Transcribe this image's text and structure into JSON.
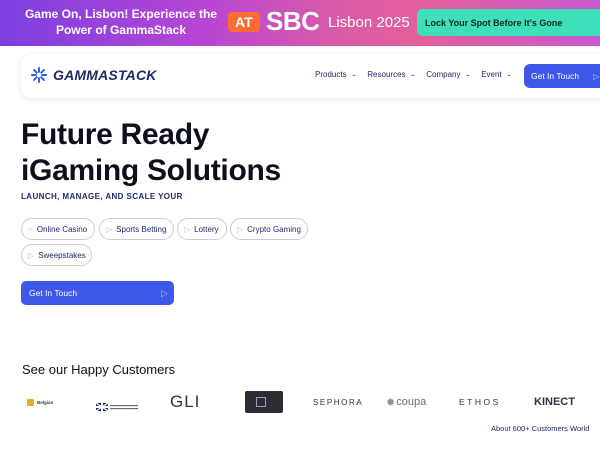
{
  "banner": {
    "headline": "Game On, Lisbon! Experience the Power of GammaStack",
    "at": "AT",
    "sbc": "SBC",
    "event": "Lisbon 2025",
    "cta": "Lock Your Spot Before It's Gone"
  },
  "nav": {
    "logo_text": "GAMMASTACK",
    "items": [
      {
        "label": "Products",
        "icon": "chevron-down-icon"
      },
      {
        "label": "Resources",
        "icon": "chevron-down-icon"
      },
      {
        "label": "Company",
        "icon": "chevron-down-icon"
      },
      {
        "label": "Event",
        "icon": "chevron-down-icon"
      }
    ],
    "cta": "Get In Touch"
  },
  "hero": {
    "title_line1": "Future Ready",
    "title_line2": "iGaming Solutions",
    "subtitle": "LAUNCH, MANAGE, AND SCALE YOUR",
    "pills": [
      "Online Casino",
      "Sports Betting",
      "Lottery",
      "Crypto Gaming",
      "Sweepstakes"
    ],
    "cta": "Get In Touch"
  },
  "customers": {
    "title": "See our Happy Customers",
    "logos": [
      "Belgian",
      "GLI",
      "SEPHORA",
      "coupa",
      "ETHOS",
      "KINECT"
    ],
    "count_text": "About 600+ Customers World"
  },
  "colors": {
    "accent": "#3d57e8",
    "banner_cta": "#3de0b8",
    "banner_at": "#ff6b35",
    "navy": "#1f2b66"
  }
}
